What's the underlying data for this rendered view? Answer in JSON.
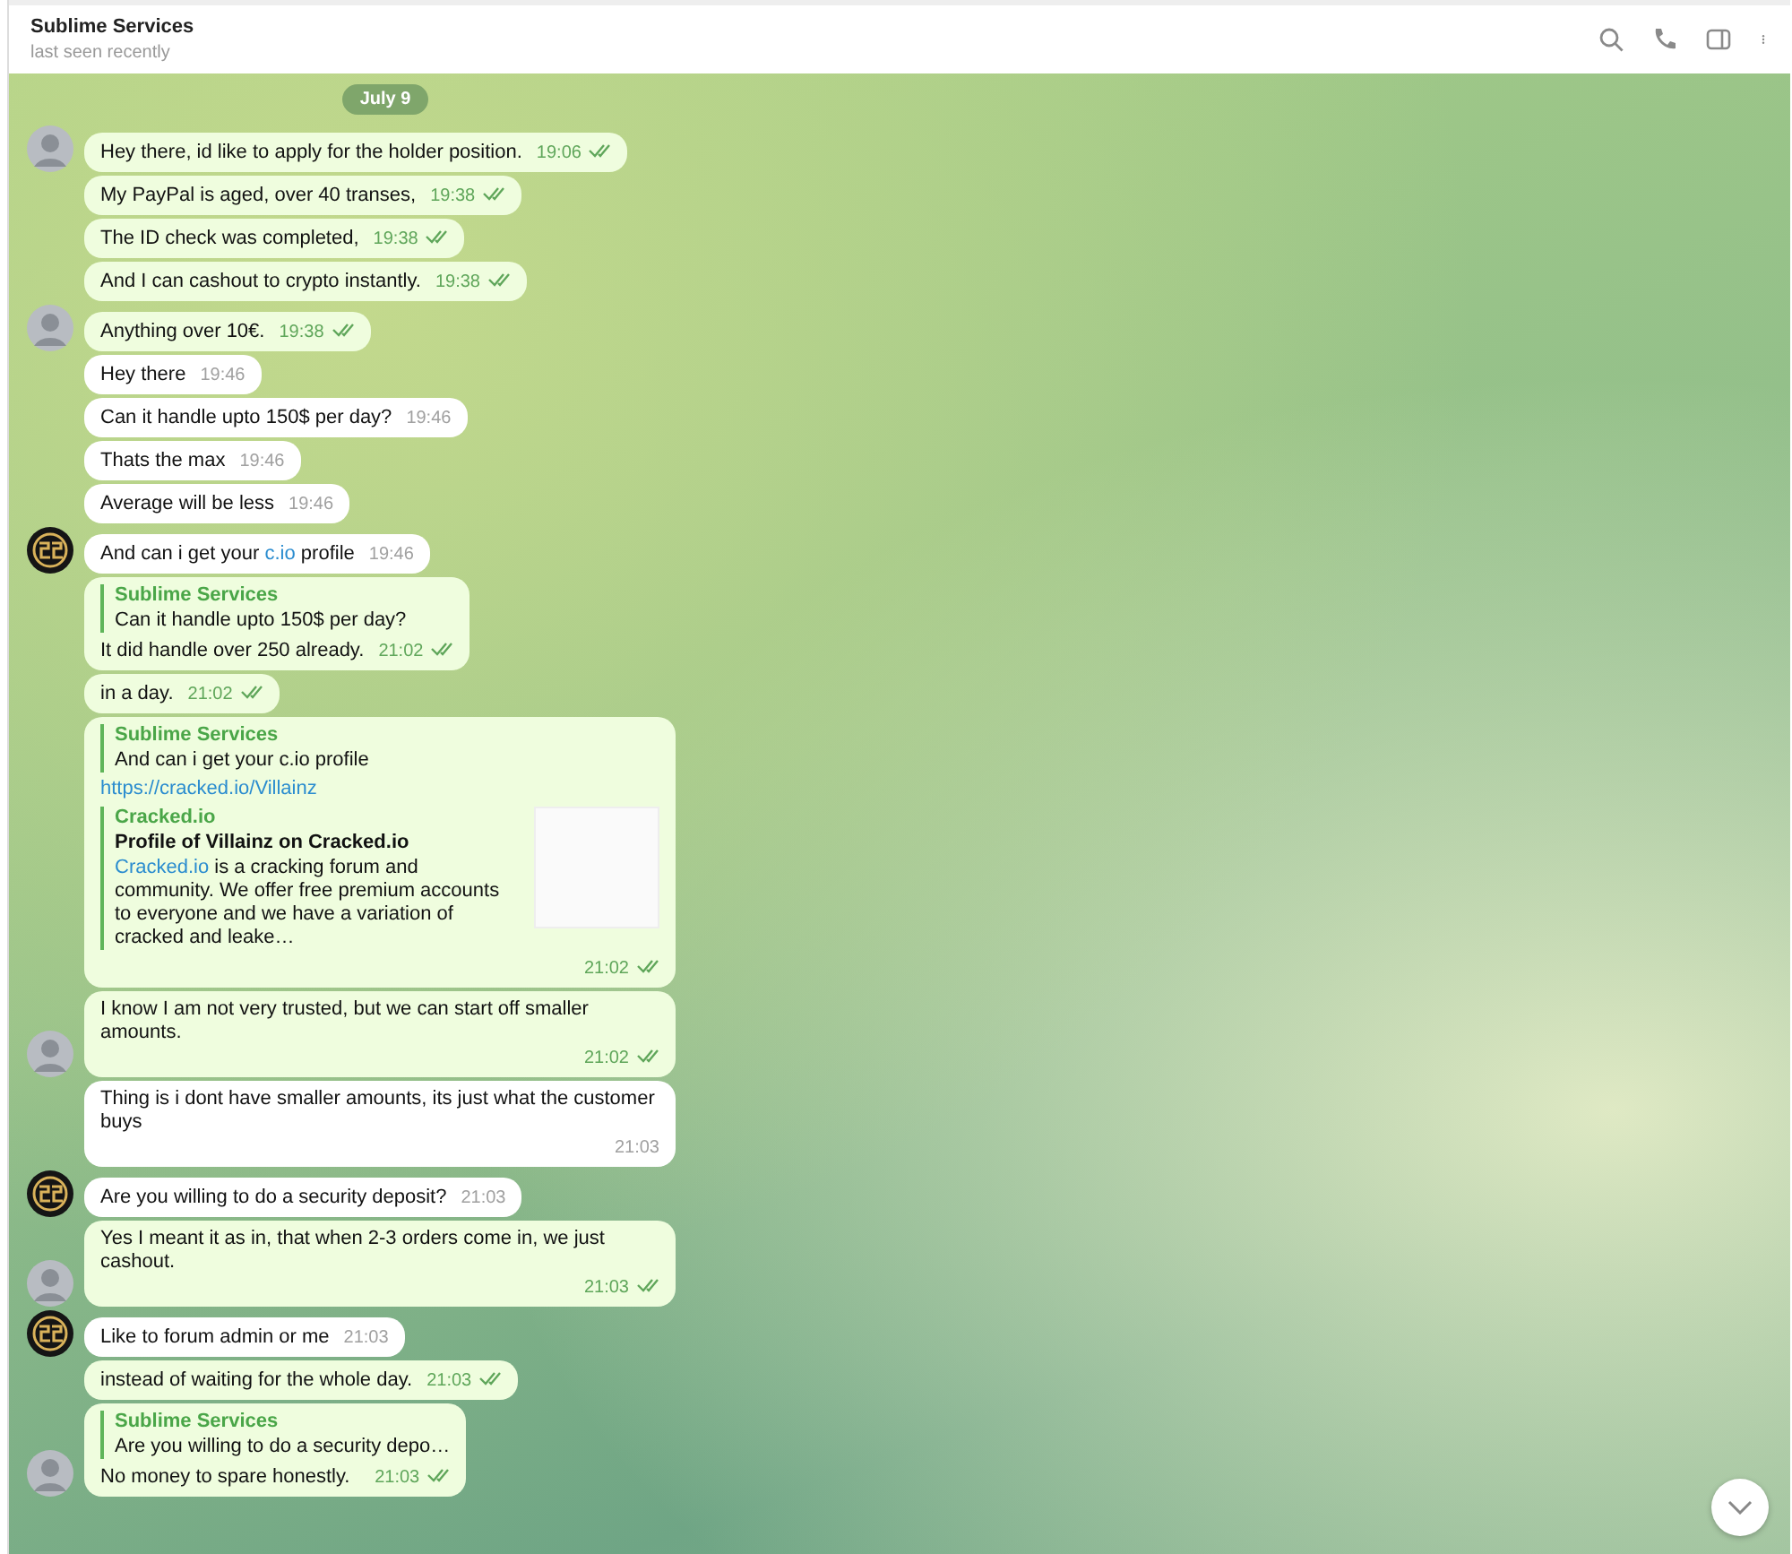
{
  "header": {
    "title": "Sublime Services",
    "status": "last seen recently"
  },
  "date": "July 9",
  "messages": [
    {
      "kind": "out",
      "avatar": true,
      "text": "Hey there, id like to apply for the holder position.",
      "time": "19:06",
      "read": true
    },
    {
      "kind": "out",
      "text": "My PayPal is aged, over 40 transes,",
      "time": "19:38",
      "read": true
    },
    {
      "kind": "out",
      "text": "The ID check was completed,",
      "time": "19:38",
      "read": true
    },
    {
      "kind": "out",
      "text": "And I can cashout to crypto instantly.",
      "time": "19:38",
      "read": true
    },
    {
      "kind": "out",
      "avatar": true,
      "text": "Anything over 10€.",
      "time": "19:38",
      "read": true
    },
    {
      "kind": "in",
      "text": "Hey there",
      "time": "19:46"
    },
    {
      "kind": "in",
      "text": "Can it handle upto 150$ per day?",
      "time": "19:46"
    },
    {
      "kind": "in",
      "text": "Thats the max",
      "time": "19:46"
    },
    {
      "kind": "in",
      "text": "Average will be less",
      "time": "19:46"
    },
    {
      "kind": "in",
      "avatar": true,
      "parts": [
        {
          "kind": "plain",
          "text": "And can i get your "
        },
        {
          "kind": "link",
          "text": "c.io"
        },
        {
          "kind": "plain",
          "text": " profile"
        }
      ],
      "time": "19:46"
    },
    {
      "kind": "out",
      "reply": {
        "author": "Sublime Services",
        "text": "Can it handle upto 150$ per day?"
      },
      "text": "It did handle over 250 already.",
      "time": "21:02",
      "read": true
    },
    {
      "kind": "out",
      "text": "in a day.",
      "time": "21:02",
      "read": true
    },
    {
      "kind": "out",
      "reply": {
        "author": "Sublime Services",
        "text": "And can i get your c.io profile"
      },
      "url": "https://cracked.io/Villainz",
      "preview": {
        "site": "Cracked.io",
        "title": "Profile of Villainz on Cracked.io",
        "desc_link": "Cracked.io",
        "desc": " is a cracking forum and community. We offer free premium accounts to everyone and we have a variation of cracked and leake…"
      },
      "time": "21:02",
      "read": true
    },
    {
      "kind": "out",
      "avatar": true,
      "text": "I know I am not very trusted, but we can start off smaller amounts.",
      "time": "21:02",
      "read": true
    },
    {
      "kind": "in",
      "text": "Thing is i dont have smaller amounts, its just what the customer buys",
      "time": "21:03"
    },
    {
      "kind": "in",
      "avatar": true,
      "text": "Are you willing to do a security deposit?",
      "time": "21:03"
    },
    {
      "kind": "out",
      "avatar": true,
      "text": "Yes I meant it as in, that when 2-3 orders come in, we just cashout.",
      "time": "21:03",
      "read": true
    },
    {
      "kind": "in",
      "avatar": true,
      "text": "Like to forum admin or me",
      "time": "21:03"
    },
    {
      "kind": "out",
      "text": "instead of waiting for the whole day.",
      "time": "21:03",
      "read": true
    },
    {
      "kind": "out",
      "avatar": true,
      "reply": {
        "author": "Sublime Services",
        "text": "Are you willing to do a security depo…"
      },
      "text": "No money to spare honestly.",
      "time": "21:03",
      "read": true
    }
  ]
}
